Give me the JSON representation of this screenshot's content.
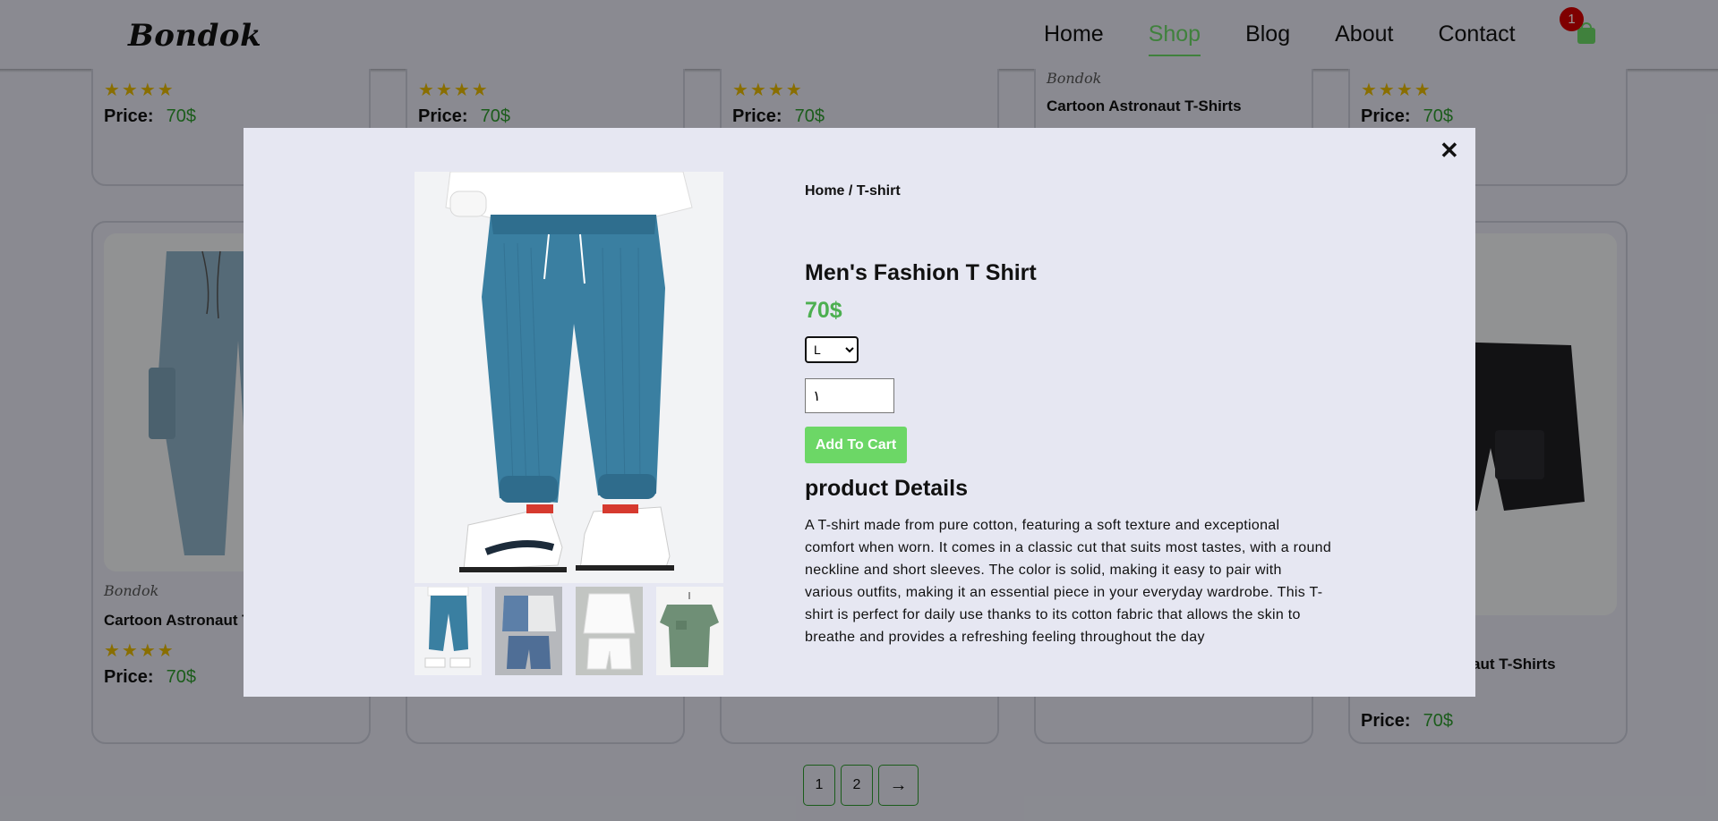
{
  "header": {
    "logo": "Bondok",
    "nav": [
      "Home",
      "Shop",
      "Blog",
      "About",
      "Contact"
    ],
    "active_nav": "Shop",
    "cart_count": "1",
    "accent_color": "#6cd766"
  },
  "grid": {
    "top_row": [
      {
        "stars": "★★★★",
        "price_label": "Price:",
        "price": "70$"
      },
      {
        "stars": "★★★★",
        "price_label": "Price:",
        "price": "70$"
      },
      {
        "stars": "★★★★",
        "price_label": "Price:",
        "price": "70$"
      },
      {
        "brand": "Bondok",
        "name": "Cartoon Astronaut T-Shirts",
        "stars": "★★★★"
      },
      {
        "stars": "★★★★",
        "price_label": "Price:",
        "price": "70$"
      }
    ],
    "bottom_left": {
      "brand": "Bondok",
      "name": "Cartoon Astronaut T-Shirts",
      "stars": "★★★★",
      "price_label": "Price:",
      "price": "70$"
    },
    "bottom_right": {
      "name": "Cartoon Astronaut T-Shirts",
      "price_label": "Price:",
      "price": "70$"
    }
  },
  "pagination": {
    "pages": [
      "1",
      "2"
    ],
    "next_icon": "arrow-right-icon"
  },
  "modal": {
    "close_icon": "close-icon",
    "breadcrumb": "Home / T-shirt",
    "title": "Men's Fashion T Shirt",
    "price": "70$",
    "size_selected": "L",
    "quantity": "١",
    "add_to_cart": "Add To Cart",
    "details_heading": "product Details",
    "description": "A T-shirt made from pure cotton, featuring a soft texture and exceptional comfort when worn. It comes in a classic cut that suits most tastes, with a round neckline and short sleeves. The color is solid, making it easy to pair with various outfits, making it an essential piece in your everyday wardrobe. This T-shirt is perfect for daily use thanks to its cotton fabric that allows the skin to breathe and provides a refreshing feeling throughout the day",
    "price_color": "#4caf50"
  }
}
